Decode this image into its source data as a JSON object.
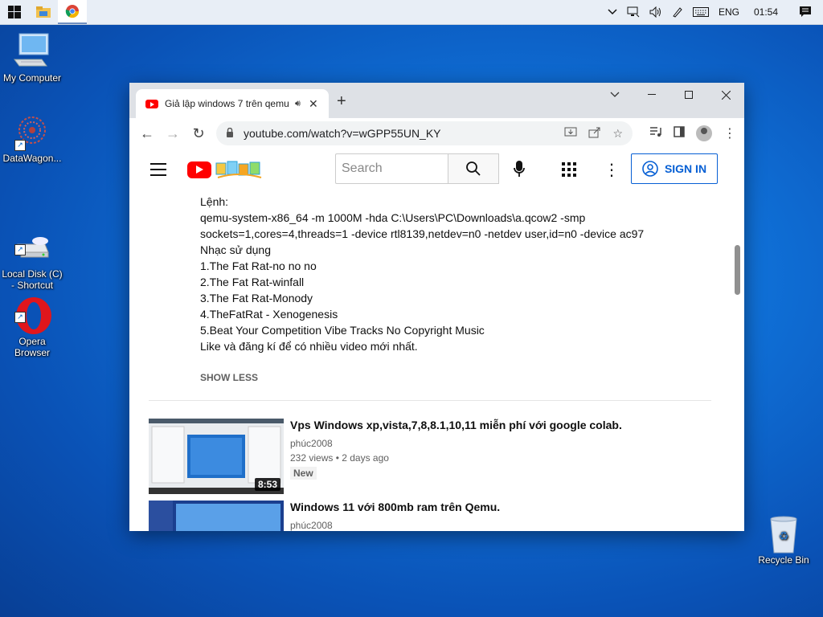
{
  "taskbar": {
    "tray": {
      "language": "ENG",
      "time": "01:54"
    }
  },
  "desktop": {
    "icons": [
      {
        "label": "My Computer"
      },
      {
        "label": "DataWagon..."
      },
      {
        "label": "Local Disk (C)\n- Shortcut"
      },
      {
        "label": "Opera\nBrowser"
      },
      {
        "label": "Recycle Bin"
      }
    ]
  },
  "browser": {
    "tab": {
      "title": "Giả lập windows 7 trên qemu"
    },
    "address": "youtube.com/watch?v=wGPP55UN_KY"
  },
  "youtube": {
    "search_placeholder": "Search",
    "sign_in": "SIGN IN",
    "description": [
      "Lệnh:",
      "qemu-system-x86_64 -m 1000M -hda C:\\Users\\PC\\Downloads\\a.qcow2 -smp",
      "sockets=1,cores=4,threads=1 -device rtl8139,netdev=n0 -netdev user,id=n0 -device ac97",
      "Nhạc sử dụng",
      "1.The Fat Rat-no no no",
      "2.The Fat Rat-winfall",
      "3.The Fat Rat-Monody",
      "4.TheFatRat - Xenogenesis",
      "5.Beat Your Competition  Vibe Tracks No Copyright Music",
      "Like và đăng kí để có nhiều video mới nhất."
    ],
    "show_less": "SHOW LESS",
    "related": [
      {
        "title": "Vps Windows xp,vista,7,8,8.1,10,11 miễn phí với google colab.",
        "channel": "phúc2008",
        "meta": "232 views • 2 days ago",
        "badge": "New",
        "duration": "8:53"
      },
      {
        "title": "Windows 11 với 800mb ram trên Qemu.",
        "channel": "phúc2008",
        "meta": "",
        "badge": "",
        "duration": ""
      }
    ]
  }
}
